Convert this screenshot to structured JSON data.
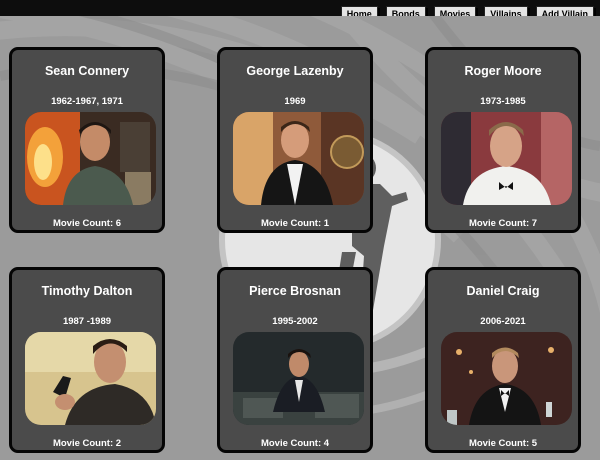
{
  "nav": {
    "items": [
      "Home",
      "Bonds",
      "Movies",
      "Villains",
      "Add Villain"
    ]
  },
  "actors": [
    {
      "name": "Sean Connery",
      "years": "1962-1967, 1971",
      "count": "Movie Count: 6"
    },
    {
      "name": "George Lazenby",
      "years": "1969",
      "count": "Movie Count: 1"
    },
    {
      "name": "Roger Moore",
      "years": "1973-1985",
      "count": "Movie Count: 7"
    },
    {
      "name": "Timothy Dalton",
      "years": "1987 -1989",
      "count": "Movie Count: 2"
    },
    {
      "name": "Pierce Brosnan",
      "years": "1995-2002",
      "count": "Movie Count: 4"
    },
    {
      "name": "Daniel Craig",
      "years": "2006-2021",
      "count": "Movie Count: 5"
    }
  ],
  "colors": {
    "topbar": "#0d0d0d",
    "background": "#9a9a9a",
    "card": "#4b4b4b",
    "card_border": "#050505",
    "nav_button": "#e4e4e4"
  }
}
